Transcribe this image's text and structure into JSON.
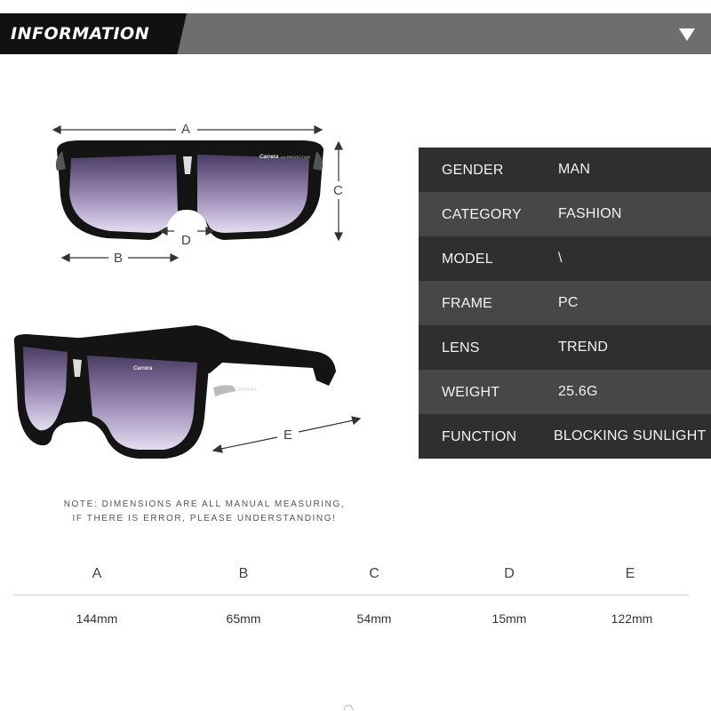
{
  "header": {
    "title": "INFORMATION",
    "toggle_icon": "triangle-down-icon"
  },
  "specs": [
    {
      "key": "GENDER",
      "value": "MAN"
    },
    {
      "key": "CATEGORY",
      "value": "FASHION"
    },
    {
      "key": "MODEL",
      "value": "\\"
    },
    {
      "key": "FRAME",
      "value": "PC"
    },
    {
      "key": "LENS",
      "value": "TREND"
    },
    {
      "key": "WEIGHT",
      "value": "25.6G"
    },
    {
      "key": "FUNCTION",
      "value": "BLOCKING SUNLIGHT"
    }
  ],
  "diagram_labels": {
    "a": "A",
    "b": "B",
    "c": "C",
    "d": "D",
    "e": "E"
  },
  "note": {
    "line1": "NOTE: DIMENSIONS ARE ALL MANUAL MEASURING,",
    "line2": "IF THERE IS ERROR, PLEASE UNDERSTANDING!"
  },
  "dimensions": [
    {
      "label": "A",
      "value": "144mm"
    },
    {
      "label": "B",
      "value": "65mm"
    },
    {
      "label": "C",
      "value": "54mm"
    },
    {
      "label": "D",
      "value": "15mm"
    },
    {
      "label": "E",
      "value": "122mm"
    }
  ],
  "colors": {
    "header_grey": "#6e6e6e",
    "header_black": "#111111",
    "row_dark": "#2f2f2f",
    "row_light": "#474747",
    "lens_purple": "#6b5a86"
  }
}
